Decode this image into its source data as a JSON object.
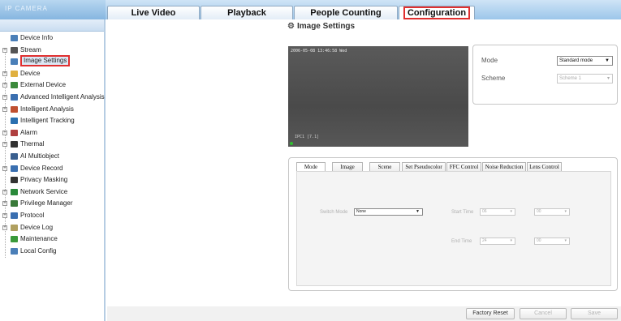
{
  "header": {
    "logo_text": "IP CAMERA",
    "tabs": [
      {
        "label": "Live Video"
      },
      {
        "label": "Playback"
      },
      {
        "label": "People Counting"
      },
      {
        "label": "Configuration"
      }
    ],
    "active_tab": "Configuration"
  },
  "sidebar": {
    "items": [
      {
        "label": "Device Info",
        "icon": "document-icon",
        "color": "#4a7fb8",
        "expandable": false
      },
      {
        "label": "Stream",
        "icon": "stream-icon",
        "color": "#555555",
        "expandable": true
      },
      {
        "label": "Image Settings",
        "icon": "image-icon",
        "color": "#4a7fb8",
        "expandable": false,
        "selected": true
      },
      {
        "label": "Device",
        "icon": "folder-icon",
        "color": "#e0b040",
        "expandable": true
      },
      {
        "label": "External Device",
        "icon": "plug-icon",
        "color": "#3c8a3c",
        "expandable": true
      },
      {
        "label": "Advanced Intelligent Analysis",
        "icon": "globe-icon",
        "color": "#3a6fb0",
        "expandable": true
      },
      {
        "label": "Intelligent Analysis",
        "icon": "analysis-icon",
        "color": "#c05030",
        "expandable": true
      },
      {
        "label": "Intelligent Tracking",
        "icon": "tracking-icon",
        "color": "#2a70b0",
        "expandable": false
      },
      {
        "label": "Alarm",
        "icon": "alarm-icon",
        "color": "#b04040",
        "expandable": true
      },
      {
        "label": "Thermal",
        "icon": "thermal-icon",
        "color": "#333333",
        "expandable": true
      },
      {
        "label": "AI Multiobject",
        "icon": "ai-icon",
        "color": "#3a5f8f",
        "expandable": false
      },
      {
        "label": "Device Record",
        "icon": "record-icon",
        "color": "#3a6fb0",
        "expandable": true
      },
      {
        "label": "Privacy Masking",
        "icon": "mask-icon",
        "color": "#333333",
        "expandable": false
      },
      {
        "label": "Network Service",
        "icon": "network-icon",
        "color": "#2a8a3a",
        "expandable": true
      },
      {
        "label": "Privilege Manager",
        "icon": "users-icon",
        "color": "#3a7a3a",
        "expandable": true
      },
      {
        "label": "Protocol",
        "icon": "protocol-icon",
        "color": "#3a6fb0",
        "expandable": true
      },
      {
        "label": "Device Log",
        "icon": "log-icon",
        "color": "#b0a060",
        "expandable": true
      },
      {
        "label": "Maintenance",
        "icon": "maintenance-icon",
        "color": "#3a9a3a",
        "expandable": false
      },
      {
        "label": "Local Config",
        "icon": "local-config-icon",
        "color": "#4a7fb8",
        "expandable": false
      }
    ]
  },
  "main": {
    "title": "Image Settings",
    "video": {
      "osd_timestamp": "2006-05-08 13:46:58 Wed",
      "osd_label": "IPC1 [7.1]"
    },
    "mode_panel": {
      "mode_label": "Mode",
      "mode_value": "Standard mode",
      "scheme_label": "Scheme",
      "scheme_value": "Scheme 1"
    },
    "subtabs": [
      {
        "label": "Mode"
      },
      {
        "label": "Image"
      },
      {
        "label": "Scene"
      },
      {
        "label": "Set Pseudocolor"
      },
      {
        "label": "FFC Control"
      },
      {
        "label": "Noise Reduction"
      },
      {
        "label": "Lens Control"
      }
    ],
    "mode_tab": {
      "switch_mode_label": "Switch Mode",
      "switch_mode_value": "None",
      "start_time_label": "Start Time",
      "start_hour": "06",
      "start_minute": "00",
      "end_time_label": "End Time",
      "end_hour": "24",
      "end_minute": "00"
    },
    "buttons": {
      "factory_reset": "Factory Reset",
      "cancel": "Cancel",
      "save": "Save"
    }
  },
  "colors": {
    "highlight_border": "#e03030",
    "header_gradient_top": "#cfe4f6",
    "header_gradient_bottom": "#9cc6ea"
  }
}
